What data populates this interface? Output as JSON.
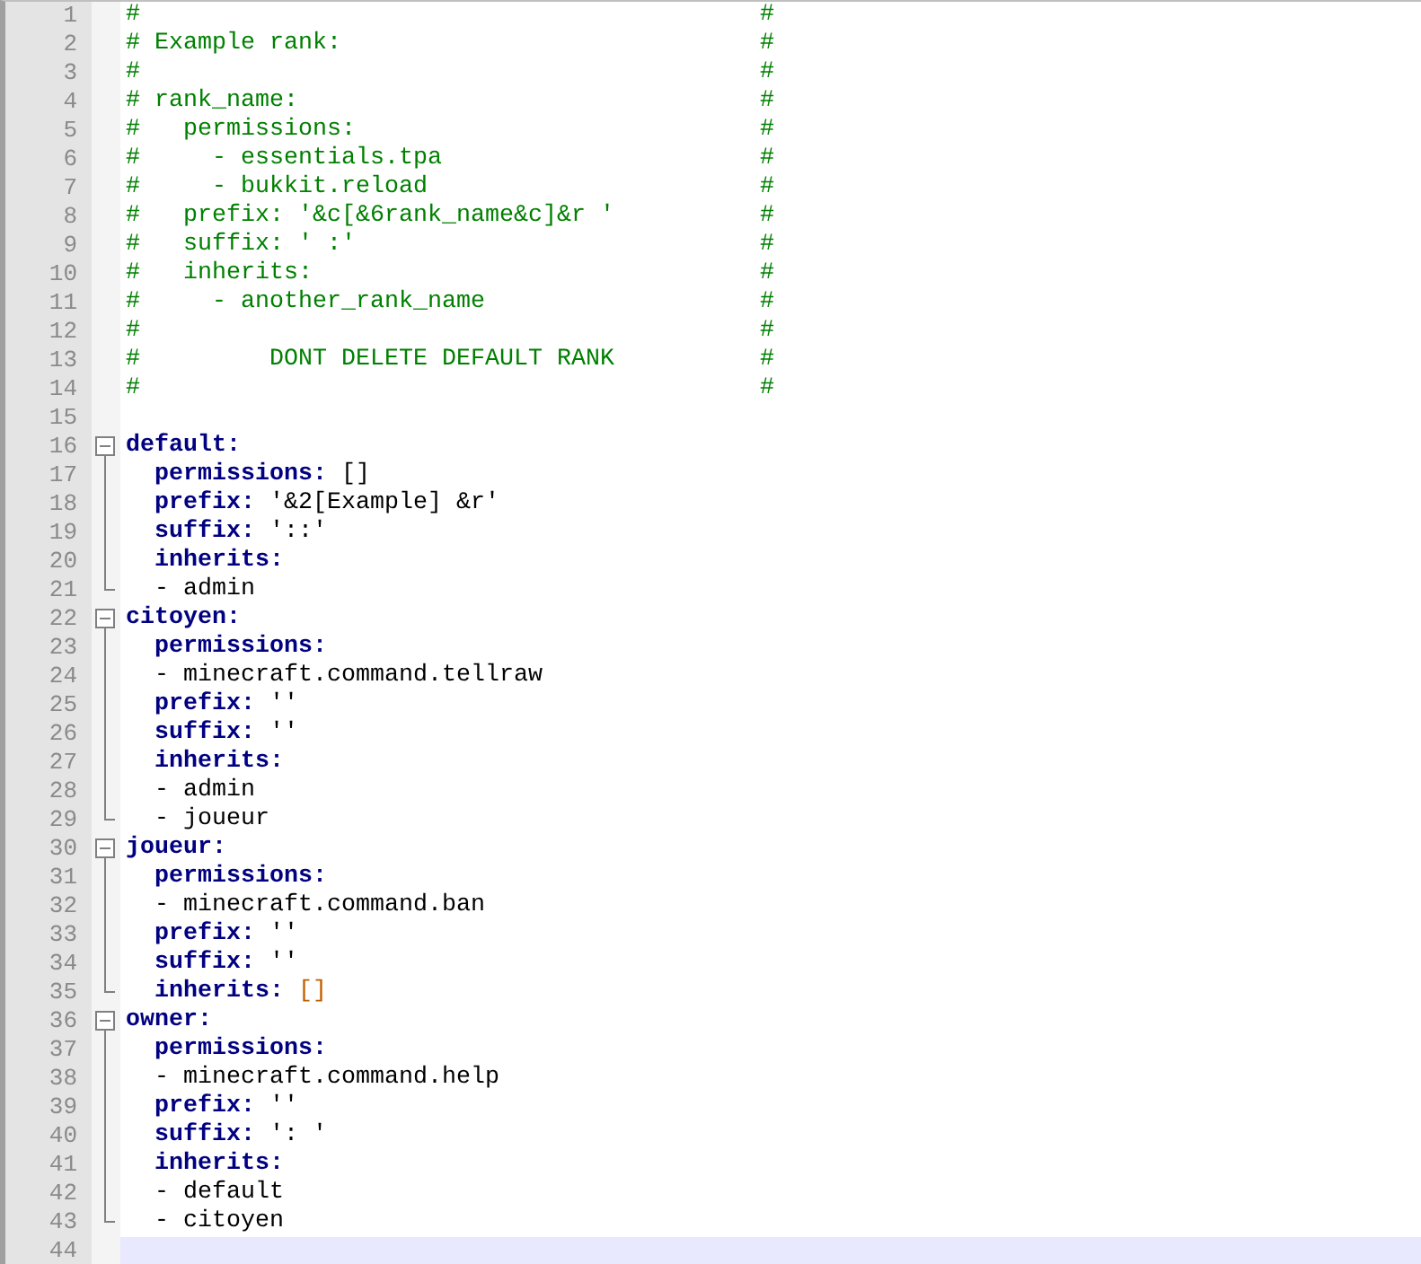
{
  "lines": [
    {
      "number": "1",
      "segments": [
        {
          "kind": "comment",
          "text": "#"
        },
        {
          "kind": "comment_end",
          "text": "#"
        }
      ]
    },
    {
      "number": "2",
      "segments": [
        {
          "kind": "comment",
          "text": "# Example rank:"
        },
        {
          "kind": "comment_end",
          "text": "#"
        }
      ]
    },
    {
      "number": "3",
      "segments": [
        {
          "kind": "comment",
          "text": "#"
        },
        {
          "kind": "comment_end",
          "text": "#"
        }
      ]
    },
    {
      "number": "4",
      "segments": [
        {
          "kind": "comment",
          "text": "#"
        },
        {
          "kind": "comment",
          "text": " rank_name:"
        },
        {
          "kind": "comment_end",
          "text": "#"
        }
      ]
    },
    {
      "number": "5",
      "segments": [
        {
          "kind": "comment",
          "text": "#"
        },
        {
          "kind": "comment",
          "text": "   permissions:"
        },
        {
          "kind": "comment_end",
          "text": "#"
        }
      ]
    },
    {
      "number": "6",
      "segments": [
        {
          "kind": "comment",
          "text": "#"
        },
        {
          "kind": "comment",
          "text": "     - essentials.tpa"
        },
        {
          "kind": "comment_end",
          "text": "#"
        }
      ]
    },
    {
      "number": "7",
      "segments": [
        {
          "kind": "comment",
          "text": "#"
        },
        {
          "kind": "comment",
          "text": "     - bukkit.reload"
        },
        {
          "kind": "comment_end",
          "text": "#"
        }
      ]
    },
    {
      "number": "8",
      "segments": [
        {
          "kind": "comment",
          "text": "#"
        },
        {
          "kind": "comment",
          "text": "   prefix: '&c[&6rank_name&c]&r '"
        },
        {
          "kind": "comment_end",
          "text": "#"
        }
      ]
    },
    {
      "number": "9",
      "segments": [
        {
          "kind": "comment",
          "text": "#"
        },
        {
          "kind": "comment",
          "text": "   suffix: ' :'"
        },
        {
          "kind": "comment_end",
          "text": "#"
        }
      ]
    },
    {
      "number": "10",
      "segments": [
        {
          "kind": "comment",
          "text": "#"
        },
        {
          "kind": "comment",
          "text": "   inherits:"
        },
        {
          "kind": "comment_end",
          "text": "#"
        }
      ]
    },
    {
      "number": "11",
      "segments": [
        {
          "kind": "comment",
          "text": "#"
        },
        {
          "kind": "comment",
          "text": "     - another_rank_name"
        },
        {
          "kind": "comment_end",
          "text": "#"
        }
      ]
    },
    {
      "number": "12",
      "segments": [
        {
          "kind": "comment",
          "text": "#"
        },
        {
          "kind": "comment_end",
          "text": "#"
        }
      ]
    },
    {
      "number": "13",
      "segments": [
        {
          "kind": "comment",
          "text": "#"
        },
        {
          "kind": "comment",
          "text": "         DONT DELETE DEFAULT RANK"
        },
        {
          "kind": "comment_end",
          "text": "#"
        }
      ]
    },
    {
      "number": "14",
      "segments": [
        {
          "kind": "comment",
          "text": "#"
        },
        {
          "kind": "comment_end",
          "text": "#"
        }
      ]
    },
    {
      "number": "15"
    },
    {
      "number": "16",
      "expanded": true,
      "segments": [
        {
          "kind": "key",
          "text": "default:"
        }
      ],
      "children": [
        {
          "number": "17",
          "segments": [
            {
              "kind": "key",
              "text": "  permissions:"
            },
            {
              "kind": "text",
              "text": " []"
            }
          ]
        },
        {
          "number": "18",
          "segments": [
            {
              "kind": "key",
              "text": "  prefix:"
            },
            {
              "kind": "text",
              "text": " '&2[Example] &r'"
            }
          ]
        },
        {
          "number": "19",
          "segments": [
            {
              "kind": "key",
              "text": "  suffix:"
            },
            {
              "kind": "text",
              "text": " '::'"
            }
          ]
        },
        {
          "number": "20",
          "segments": [
            {
              "kind": "key",
              "text": "  inherits:"
            }
          ]
        },
        {
          "number": "21",
          "segments": [
            {
              "kind": "text",
              "text": "  - admin"
            }
          ]
        }
      ]
    },
    {
      "number": "22",
      "expanded": true,
      "segments": [
        {
          "kind": "key",
          "text": "citoyen:"
        }
      ],
      "children": [
        {
          "number": "23",
          "segments": [
            {
              "kind": "key",
              "text": "  permissions:"
            }
          ]
        },
        {
          "number": "24",
          "segments": [
            {
              "kind": "text",
              "text": "  - minecraft.command.tellraw"
            }
          ]
        },
        {
          "number": "25",
          "segments": [
            {
              "kind": "key",
              "text": "  prefix:"
            },
            {
              "kind": "text",
              "text": " ''"
            }
          ]
        },
        {
          "number": "26",
          "segments": [
            {
              "kind": "key",
              "text": "  suffix:"
            },
            {
              "kind": "text",
              "text": " ''"
            }
          ]
        },
        {
          "number": "27",
          "segments": [
            {
              "kind": "key",
              "text": "  inherits:"
            }
          ]
        },
        {
          "number": "28",
          "segments": [
            {
              "kind": "text",
              "text": "  - admin"
            }
          ]
        },
        {
          "number": "29",
          "segments": [
            {
              "kind": "text",
              "text": "  - joueur"
            }
          ]
        }
      ]
    },
    {
      "number": "30",
      "expanded": true,
      "segments": [
        {
          "kind": "key",
          "text": "joueur:"
        }
      ],
      "children": [
        {
          "number": "31",
          "segments": [
            {
              "kind": "key",
              "text": "  permissions:"
            }
          ]
        },
        {
          "number": "32",
          "segments": [
            {
              "kind": "text",
              "text": "  - minecraft.command.ban"
            }
          ]
        },
        {
          "number": "33",
          "segments": [
            {
              "kind": "key",
              "text": "  prefix:"
            },
            {
              "kind": "text",
              "text": " ''"
            }
          ]
        },
        {
          "number": "34",
          "segments": [
            {
              "kind": "key",
              "text": "  suffix:"
            },
            {
              "kind": "text",
              "text": " ''"
            }
          ]
        },
        {
          "number": "35",
          "segments": [
            {
              "kind": "key",
              "text": "  inherits:"
            },
            {
              "kind": "bracket",
              "text": " []"
            }
          ]
        }
      ]
    },
    {
      "number": "36",
      "expanded": true,
      "segments": [
        {
          "kind": "key",
          "text": "owner:"
        }
      ],
      "children": [
        {
          "number": "37",
          "segments": [
            {
              "kind": "key",
              "text": "  permissions:"
            }
          ]
        },
        {
          "number": "38",
          "segments": [
            {
              "kind": "text",
              "text": "  - minecraft.command.help"
            }
          ]
        },
        {
          "number": "39",
          "segments": [
            {
              "kind": "key",
              "text": "  prefix:"
            },
            {
              "kind": "text",
              "text": " ''"
            }
          ]
        },
        {
          "number": "40",
          "segments": [
            {
              "kind": "key",
              "text": "  suffix:"
            },
            {
              "kind": "text",
              "text": " ': '"
            }
          ]
        },
        {
          "number": "41",
          "segments": [
            {
              "kind": "key",
              "text": "  inherits:"
            }
          ]
        },
        {
          "number": "42",
          "segments": [
            {
              "kind": "text",
              "text": "  - default"
            }
          ]
        },
        {
          "number": "43",
          "segments": [
            {
              "kind": "text",
              "text": "  - citoyen"
            }
          ]
        }
      ]
    },
    {
      "number": "44",
      "current": true
    }
  ]
}
